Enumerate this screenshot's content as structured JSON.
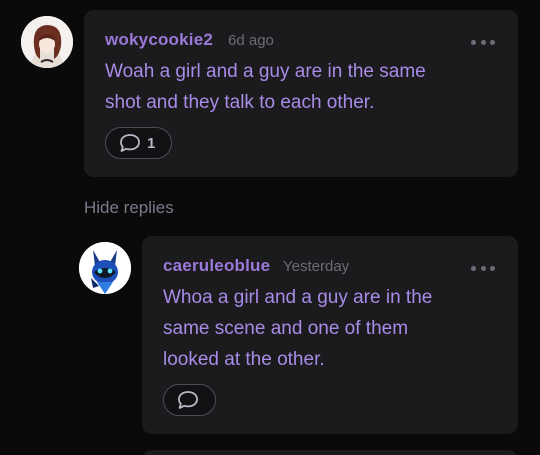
{
  "comments": [
    {
      "username": "wokycookie2",
      "timestamp": "6d ago",
      "body_line1": "Woah a girl and a guy are in the same",
      "body_line2": "shot and they talk to each other.",
      "reply_count": "1",
      "menu_icon": "more-horizontal-icon",
      "reply_icon": "speech-bubble-icon"
    },
    {
      "username": "caeruleoblue",
      "timestamp": "Yesterday",
      "body_line1": "Whoa a girl and a guy are in the",
      "body_line2": "same scene and one of them",
      "body_line3": "looked at the other.",
      "menu_icon": "more-horizontal-icon",
      "reply_icon": "speech-bubble-icon"
    }
  ],
  "thread": {
    "hide_replies_label": "Hide replies"
  },
  "colors": {
    "background": "#0a0a0b",
    "card": "#1b1b1e",
    "username": "#9b79d8",
    "body_text": "#a88be6",
    "muted": "#6c6c78"
  }
}
